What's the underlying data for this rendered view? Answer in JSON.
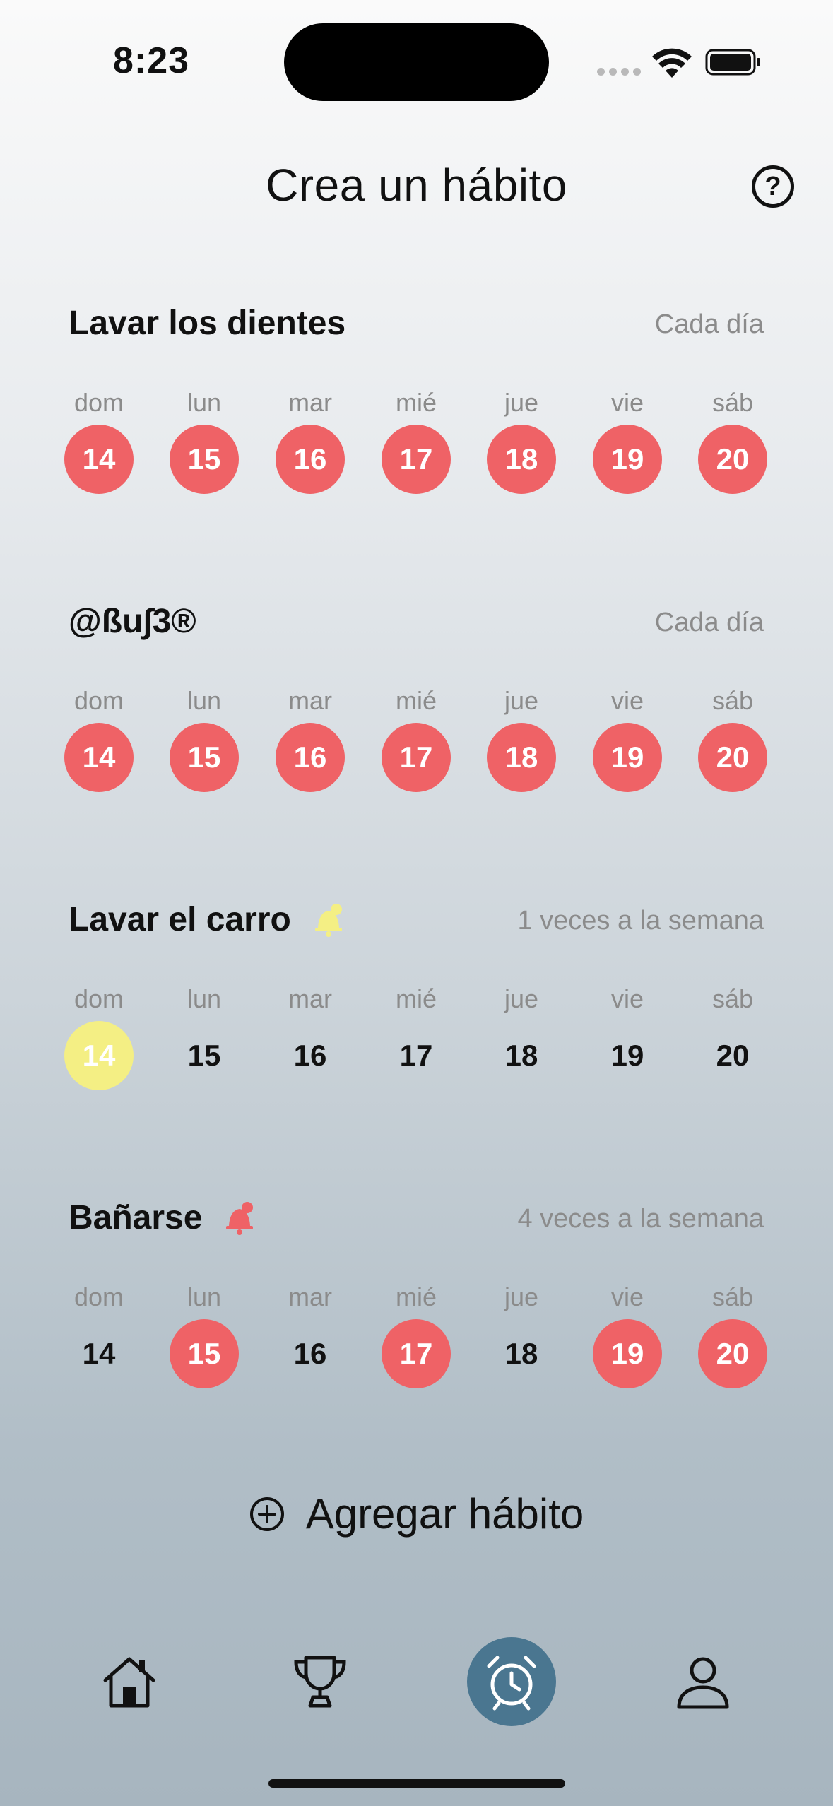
{
  "status_bar": {
    "time": "8:23"
  },
  "header": {
    "title": "Crea un hábito",
    "help_label": "?"
  },
  "habits": [
    {
      "name": "Lavar los dientes",
      "frequency": "Cada día",
      "has_bell": false,
      "days": [
        {
          "label": "dom",
          "num": "14",
          "state": "red"
        },
        {
          "label": "lun",
          "num": "15",
          "state": "red"
        },
        {
          "label": "mar",
          "num": "16",
          "state": "red"
        },
        {
          "label": "mié",
          "num": "17",
          "state": "red"
        },
        {
          "label": "jue",
          "num": "18",
          "state": "red"
        },
        {
          "label": "vie",
          "num": "19",
          "state": "red"
        },
        {
          "label": "sáb",
          "num": "20",
          "state": "red"
        }
      ]
    },
    {
      "name": "@ßu∫3®",
      "frequency": "Cada día",
      "has_bell": false,
      "days": [
        {
          "label": "dom",
          "num": "14",
          "state": "red"
        },
        {
          "label": "lun",
          "num": "15",
          "state": "red"
        },
        {
          "label": "mar",
          "num": "16",
          "state": "red"
        },
        {
          "label": "mié",
          "num": "17",
          "state": "red"
        },
        {
          "label": "jue",
          "num": "18",
          "state": "red"
        },
        {
          "label": "vie",
          "num": "19",
          "state": "red"
        },
        {
          "label": "sáb",
          "num": "20",
          "state": "red"
        }
      ]
    },
    {
      "name": "Lavar el carro",
      "frequency": "1 veces a la semana",
      "has_bell": true,
      "bell_color": "#f4ef84",
      "days": [
        {
          "label": "dom",
          "num": "14",
          "state": "yellow"
        },
        {
          "label": "lun",
          "num": "15",
          "state": "none"
        },
        {
          "label": "mar",
          "num": "16",
          "state": "none"
        },
        {
          "label": "mié",
          "num": "17",
          "state": "none"
        },
        {
          "label": "jue",
          "num": "18",
          "state": "none"
        },
        {
          "label": "vie",
          "num": "19",
          "state": "none"
        },
        {
          "label": "sáb",
          "num": "20",
          "state": "none"
        }
      ]
    },
    {
      "name": "Bañarse",
      "frequency": "4 veces a la semana",
      "has_bell": true,
      "bell_color": "#ef6266",
      "days": [
        {
          "label": "dom",
          "num": "14",
          "state": "none"
        },
        {
          "label": "lun",
          "num": "15",
          "state": "red"
        },
        {
          "label": "mar",
          "num": "16",
          "state": "none"
        },
        {
          "label": "mié",
          "num": "17",
          "state": "red"
        },
        {
          "label": "jue",
          "num": "18",
          "state": "none"
        },
        {
          "label": "vie",
          "num": "19",
          "state": "red"
        },
        {
          "label": "sáb",
          "num": "20",
          "state": "red"
        }
      ]
    }
  ],
  "add_habit": {
    "label": "Agregar hábito",
    "icon": "plus-circle-icon"
  },
  "tabbar": {
    "items": [
      {
        "name": "home",
        "icon": "home-icon",
        "active": false
      },
      {
        "name": "trophy",
        "icon": "trophy-icon",
        "active": false
      },
      {
        "name": "alarm",
        "icon": "alarm-clock-icon",
        "active": true
      },
      {
        "name": "profile",
        "icon": "person-icon",
        "active": false
      }
    ]
  },
  "colors": {
    "red": "#ef6266",
    "yellow": "#f4ef84",
    "active_tab": "#4a7690"
  }
}
